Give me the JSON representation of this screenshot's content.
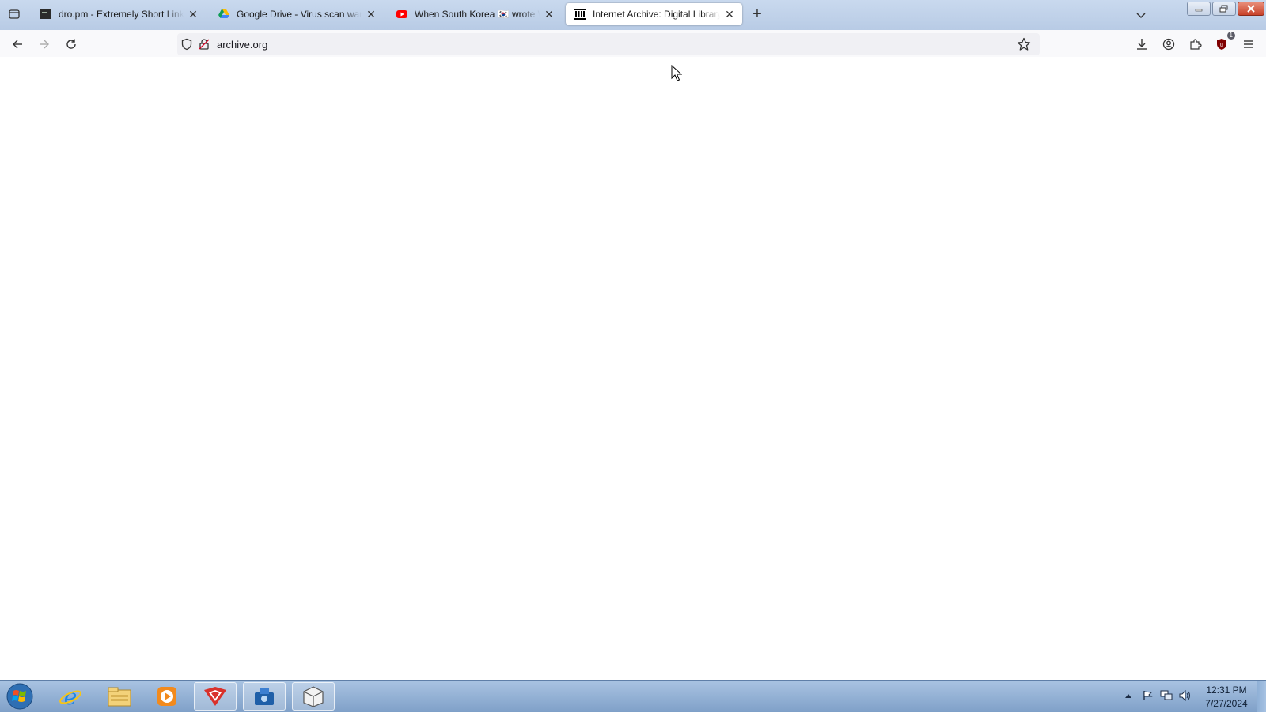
{
  "browser": {
    "tabs": [
      {
        "title": "dro.pm - Extremely Short Links",
        "icon": "dropm-favicon",
        "active": false
      },
      {
        "title": "Google Drive - Virus scan warning",
        "icon": "google-drive-favicon",
        "active": false
      },
      {
        "title": "When South Korea 🇰🇷 wrote World",
        "icon": "youtube-favicon",
        "active": false
      },
      {
        "title": "Internet Archive: Digital Library",
        "icon": "internet-archive-favicon",
        "active": true
      }
    ],
    "url": "archive.org",
    "extension_badge": "1"
  },
  "taskbar": {
    "apps": [
      "start-orb",
      "internet-explorer",
      "windows-explorer",
      "media-player",
      "app-red",
      "app-blue",
      "app-box"
    ],
    "clock": {
      "time": "12:31 PM",
      "date": "7/27/2024"
    }
  },
  "colors": {
    "tabbar": "#c0d3ea",
    "navbar": "#f9f9fb",
    "taskbar": "#8fb0d6"
  }
}
